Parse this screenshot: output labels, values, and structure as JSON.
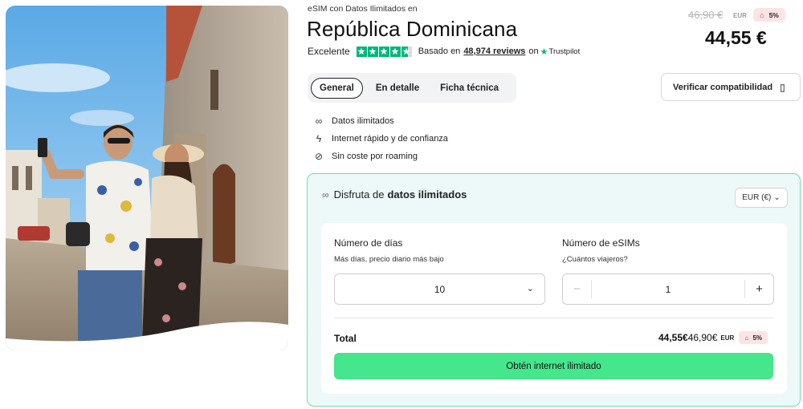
{
  "hero": {
    "alt": "Pareja de viajeros tomando un selfie en una calle colonial"
  },
  "header": {
    "eyebrow": "eSIM con Datos Ilimitados en",
    "title": "República Dominicana",
    "rating_label": "Excelente",
    "stars": 4.5,
    "based_on": "Basado en",
    "reviews": "48,974 reviews",
    "on": "on",
    "platform": "Trustpilot"
  },
  "pricing": {
    "old_price": "46,90 €",
    "old_currency": "EUR",
    "discount": "5%",
    "price": "44,55 €"
  },
  "tabs": [
    {
      "label": "General",
      "active": true
    },
    {
      "label": "En detalle",
      "active": false
    },
    {
      "label": "Ficha técnica",
      "active": false
    }
  ],
  "compat_button": "Verificar compatibilidad",
  "features": [
    {
      "icon": "infinity-icon",
      "label": "Datos ilimitados"
    },
    {
      "icon": "bolt-icon",
      "label": "Internet rápido y de confianza"
    },
    {
      "icon": "no-roaming-icon",
      "label": "Sin coste por roaming"
    }
  ],
  "card": {
    "heading_prefix": "Disfruta de",
    "heading_bold": "datos ilimitados",
    "currency_select": "EUR (€)",
    "days_label": "Número de días",
    "days_sub": "Más días, precio diario más bajo",
    "days_value": "10",
    "esims_label": "Número de eSIMs",
    "esims_sub": "¿Cuántos viajeros?",
    "esims_value": "1",
    "minus": "−",
    "plus": "+",
    "total_label": "Total",
    "total_price": "44,55€",
    "total_old": "46,90€",
    "total_currency": "EUR",
    "total_discount": "5%",
    "cta": "Obtén internet ilimitado"
  },
  "colors": {
    "accent_green": "#45e68c",
    "card_border": "#6ee0a8",
    "card_bg": "#ecf9f8",
    "trustpilot_green": "#00b67a",
    "discount_bg": "#fde4e4"
  }
}
